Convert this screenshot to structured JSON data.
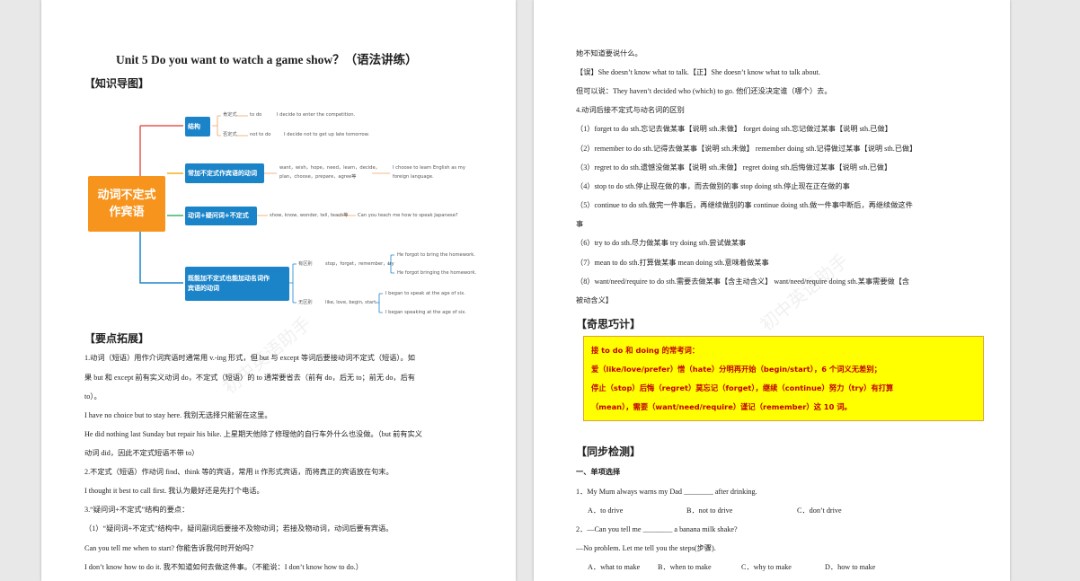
{
  "left": {
    "title": "Unit 5    Do you want to watch a game show？（语法讲练）",
    "section_mindmap": "【知识导图】",
    "mindmap": {
      "center": "动词不定式作宾语",
      "center_line1": "动词不定式",
      "center_line2": "作宾语",
      "b1": "结构",
      "b1_pos": "肯定式",
      "b1_pos_form": "to do",
      "b1_pos_ex": "I decide to enter the competition.",
      "b1_neg": "否定式",
      "b1_neg_form": "not to do",
      "b1_neg_ex": "I decide not to get up late tomorrow.",
      "b2": "常加不定式作宾语的动词",
      "b2_verbs1": "want，wish，hope，need，learn，decide，",
      "b2_verbs2": "plan，choose，prepare，agree等",
      "b2_ex1": "I choose to learn English as my",
      "b2_ex2": "foreign language.",
      "b3": "动词+疑问词+不定式",
      "b3_verbs": "show, know, wonder, tell, teach等",
      "b3_ex": "Can you teach me how to speak Japanese?",
      "b4_line1": "既能加不定式也能加动名词作",
      "b4_line2": "宾语的动词",
      "b4_diff": "有区别",
      "b4_diff_verbs": "stop，forget，remember，try",
      "b4_diff_ex1": "He forgot to bring the homework.",
      "b4_diff_ex2": "He forgot bringing the homework.",
      "b4_same": "无区别",
      "b4_same_verbs": "like, love, begin, start",
      "b4_same_ex1": "I began to speak at the age of six.",
      "b4_same_ex2": "I began speaking at the age of six."
    },
    "section_points": "【要点拓展】",
    "lines": [
      "1.动词（短语）用作介词宾语时通常用 v.-ing 形式，但 but 与 except 等词后要接动词不定式（短语）。如",
      "果 but 和 except 前有实义动词 do，不定式（短语）的 to 通常要省去（前有 do，后无 to；前无 do，后有",
      "to）。",
      "I have no choice but to stay here.  我别无选择只能留在这里。",
      "He did nothing last Sunday but repair his bike.  上星期天他除了修理他的自行车外什么也没做。（but 前有实义",
      "动词 did，因此不定式短语不带 to）",
      "2.不定式（短语）作动词 find、think 等的宾语，常用 it 作形式宾语，而将真正的宾语放在句末。",
      "I thought it best to call first.  我认为最好还是先打个电话。",
      "3.“疑问词+不定式”结构的要点：",
      "（1）“疑问词+不定式”结构中，疑问副词后要接不及物动词；若接及物动词，动词后要有宾语。",
      "Can you tell me when to start?  你能告诉我何时开始吗？",
      "I don’t know how to do it.  我不知道如何去做这件事。（不能说：I don’t know how to do.）"
    ],
    "watermark": "初中英语助手"
  },
  "right": {
    "lines_top": [
      "她不知道要说什么。",
      "【误】She doesn’t know what to talk.【正】She doesn’t know what to talk about.",
      "但可以说：They haven’t decided who (which) to go.  他们还没决定谁（哪个）去。",
      "4.动词后接不定式与动名词的区别",
      "（1）forget to do sth.忘记去做某事【说明 sth.未做】     forget doing sth.忘记做过某事【说明 sth.已做】",
      "（2）remember to do sth.记得去做某事【说明 sth.未做】     remember doing sth.记得做过某事【说明 sth.已做】",
      "（3）regret to do sth.遗憾没做某事【说明 sth.未做】     regret doing sth.后悔做过某事【说明 sth.已做】",
      "（4）stop to do sth.停止现在做的事，而去做别的事     stop doing sth.停止现在正在做的事",
      "（5）continue to do sth.做完一件事后，再继续做别的事     continue doing sth.做一件事中断后，再继续做这件",
      "事",
      "（6）try to do sth.尽力做某事     try doing sth.尝试做某事",
      "（7）mean to do sth.打算做某事     mean doing sth.意味着做某事",
      "（8）want/need/require to do sth.需要去做某事【含主动含义】     want/need/require doing sth.某事需要做【含",
      "被动含义】"
    ],
    "section_tips": "【奇思巧计】",
    "tips": [
      "接 to do 和 doing 的常考词：",
      "爱（like/love/prefer）憎（hate）分明再开始（begin/start），6 个词义无差别；",
      "停止（stop）后悔（regret）莫忘记（forget），继续（continue）努力（try）有打算",
      "（mean），需要（want/need/require）谨记（remember）这 10 词。"
    ],
    "section_test": "【同步检测】",
    "part1": "一、单项选择",
    "q1": "1．My Mum always warns my Dad ________ after drinking.",
    "q1_opts": [
      "A．to drive",
      "B．not to drive",
      "C．don’t drive"
    ],
    "q2a": "2．—Can you tell me ________ a banana milk shake?",
    "q2b": "—No problem. Let me tell you the steps(步骤).",
    "q2_opts": [
      "A．what to make",
      "B．when to make",
      "C．why to make",
      "D．how to make"
    ],
    "watermark": "初中英语助手"
  }
}
